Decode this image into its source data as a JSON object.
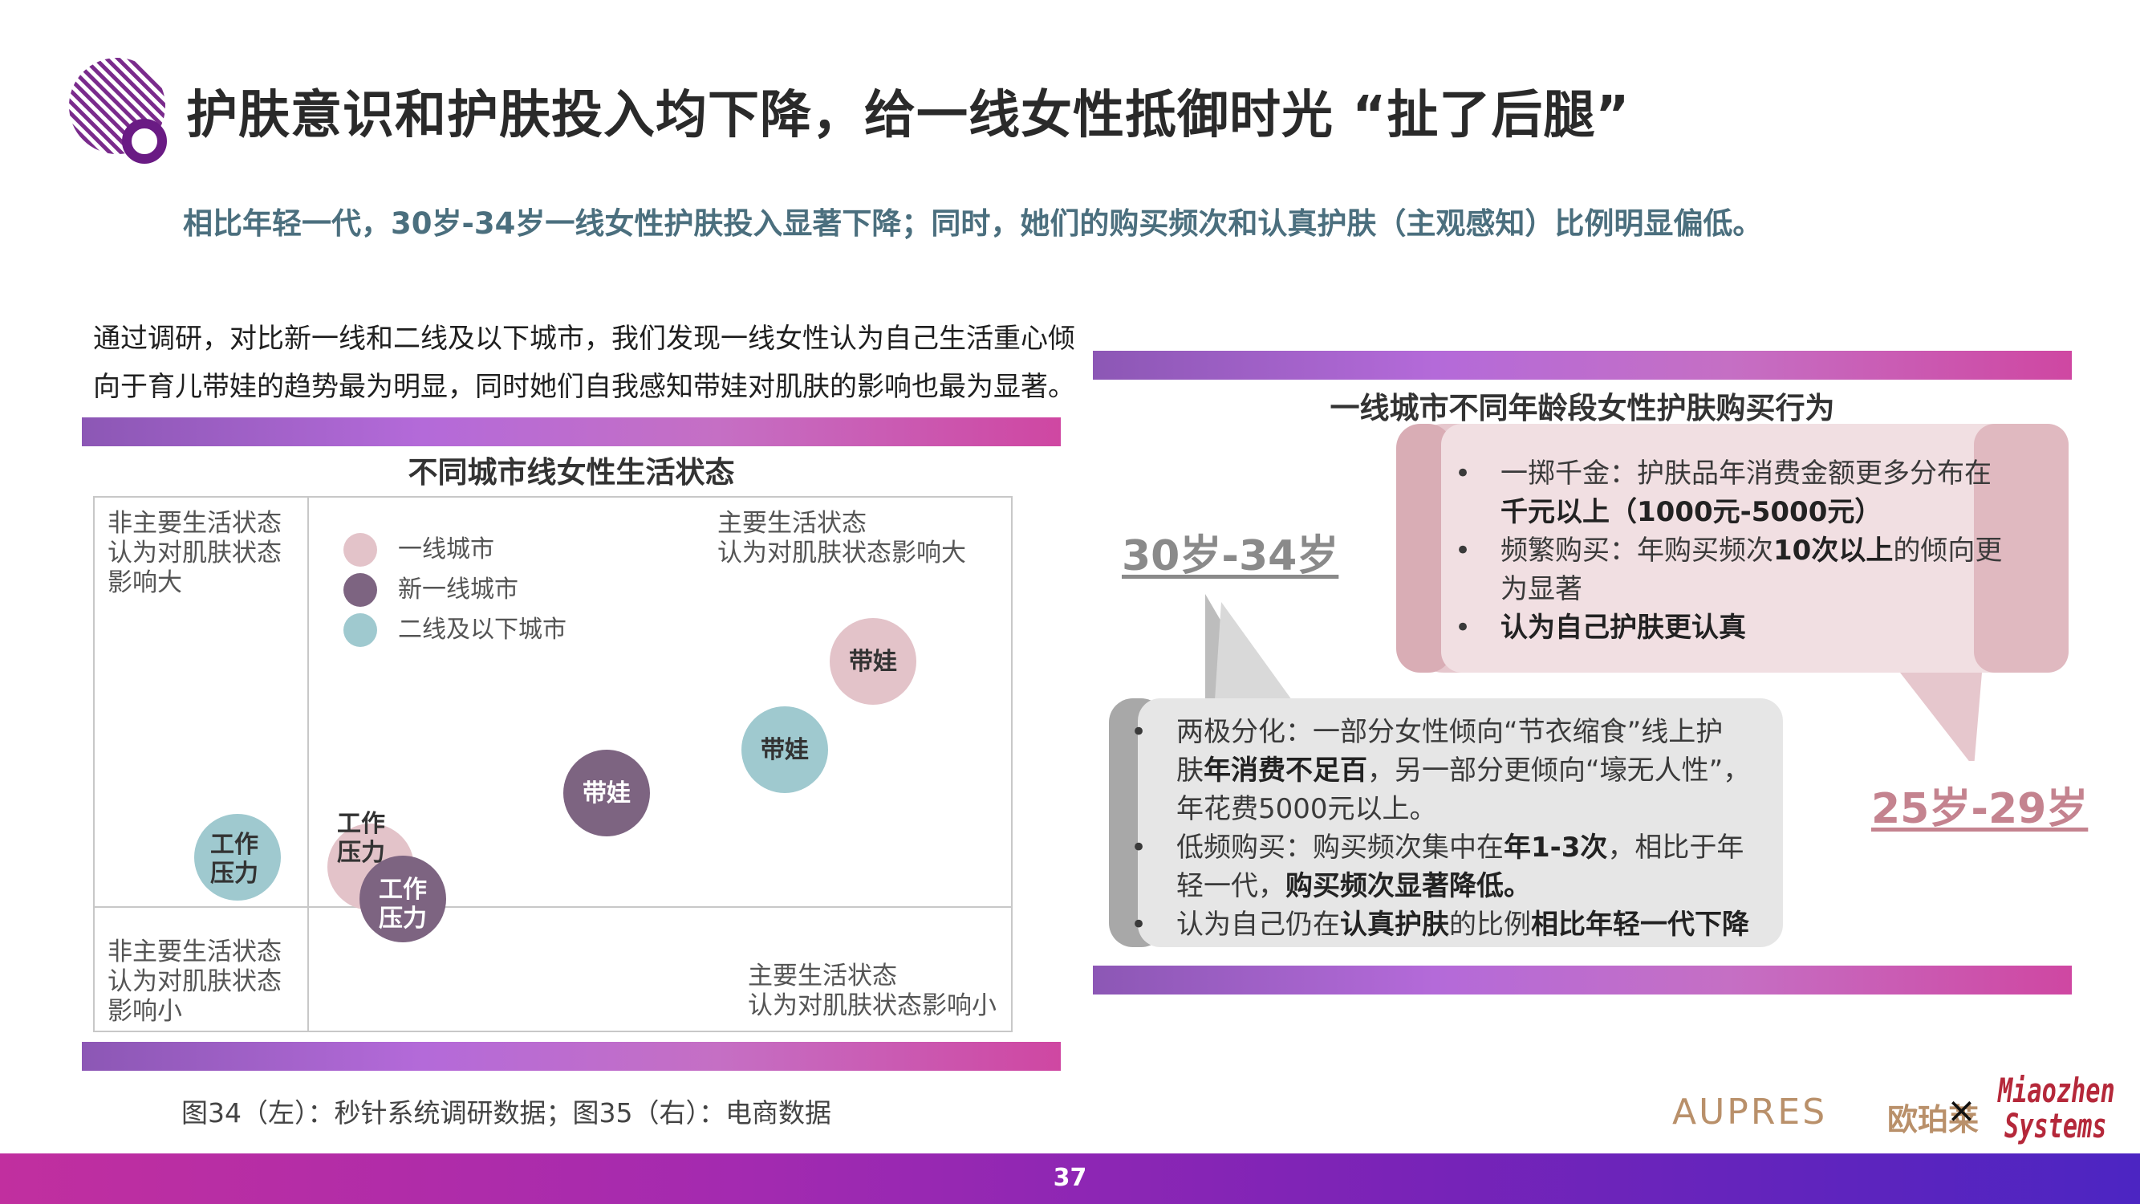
{
  "header": {
    "title": "护肤意识和护肤投入均下降，给一线女性抵御时光 “扯了后腿”",
    "subtitle": "相比年轻一代，30岁-34岁一线女性护肤投入显著下降；同时，她们的购买频次和认真护肤（主观感知）比例明显偏低。"
  },
  "intro": {
    "line1": "通过调研，对比新一线和二线及以下城市，我们发现一线女性认为自己生活重心倾",
    "line2": "向于育儿带娃的趋势最为明显，同时她们自我感知带娃对肌肤的影响也最为显著。"
  },
  "left_chart": {
    "title": "不同城市线女性生活状态",
    "quadrants": {
      "top_left": [
        "非主要生活状态",
        "认为对肌肤状态",
        "影响大"
      ],
      "top_right": [
        "主要生活状态",
        "认为对肌肤状态影响大"
      ],
      "bottom_left": [
        "非主要生活状态",
        "认为对肌肤状态",
        "影响小"
      ],
      "bottom_right": [
        "主要生活状态",
        "认为对肌肤状态影响小"
      ]
    },
    "legend": [
      "一线城市",
      "新一线城市",
      "二线及以下城市"
    ],
    "bubble_labels": {
      "tier1_childcare": "带娃",
      "newtier1_childcare": "带娃",
      "tier2_childcare": "带娃",
      "tier1_work_l1": "工作",
      "tier1_work_l2": "压力",
      "newtier1_work_l1": "工作",
      "newtier1_work_l2": "压力",
      "tier2_work_l1": "工作",
      "tier2_work_l2": "压力"
    }
  },
  "colors": {
    "tier1": "#e3c3c9",
    "new_tier1": "#7d6481",
    "tier2": "#9fc9cf",
    "accent_purple": "#a96bd6",
    "pink_bubble": "#e8c9cf",
    "gray_bubble": "#e6e6e6"
  },
  "right_section": {
    "title": "一线城市不同年龄段女性护肤购买行为",
    "age_30_34": "30岁-34岁",
    "age_25_29": "25岁-29岁",
    "pink_bullets": [
      {
        "pre": "一掷千金：护肤品年消费金额更多分布在",
        "bold": "",
        "post": ""
      },
      {
        "pre": "",
        "bold": "千元以上（1000元-5000元）",
        "post": ""
      },
      {
        "pre": "频繁购买：年购买频次",
        "bold": "10次以上",
        "post": "的倾向更"
      },
      {
        "pre": "为显著",
        "bold": "",
        "post": ""
      },
      {
        "pre": "",
        "bold": "认为自己护肤更认真",
        "post": ""
      }
    ],
    "gray_bullets": [
      {
        "t1": "两极分化：一部分女性倾向“节衣缩食”线上护"
      },
      {
        "t1": "肤",
        "b1": "年消费不足百",
        "t2": "，另一部分更倾向“壕无人性”，"
      },
      {
        "t1": "年花费5000元以上。"
      },
      {
        "t1": "低频购买：购买频次集中在",
        "b1": "年1-3次",
        "t2": "，相比于年"
      },
      {
        "t1": "轻一代，",
        "b1": "购买频次显著降低。"
      },
      {
        "t1": "认为自己仍在",
        "b1": "认真护肤",
        "t2": "的比例",
        "b2": "相比年轻一代下降"
      }
    ]
  },
  "source": "图34（左）：秒针系统调研数据；图35（右）：电商数据",
  "brands": {
    "aupres": "AUPRES",
    "aupres_cn": "欧珀莱",
    "times": "×",
    "miaozhen_1": "Miaozhen",
    "miaozhen_2": "Systems"
  },
  "footer": {
    "page_number": "37"
  }
}
